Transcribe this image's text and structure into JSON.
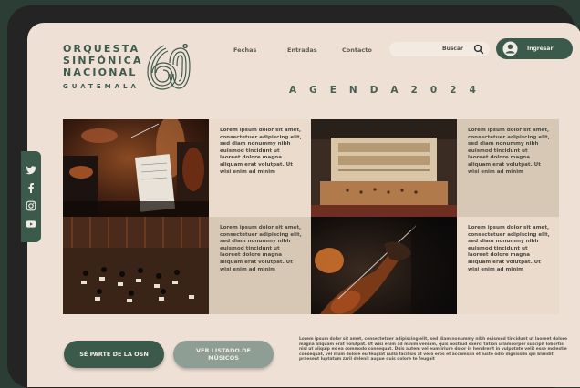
{
  "logo": {
    "line1": "ORQUESTA",
    "line2": "SINFÓNICA",
    "line3": "NACIONAL",
    "sub": "GUATEMALA",
    "degree": "o"
  },
  "nav": {
    "links": [
      "Fechas",
      "Entradas",
      "Contacto"
    ],
    "search_label": "Buscar",
    "login_label": "Ingresar"
  },
  "agenda_title": "AGENDA2024",
  "cards": [
    {
      "text": "Lorem ipsum dolor sit amet, consectetuer adipiscing elit, sed diam nonummy nibh euismod tincidunt ut laoreet dolore magna aliquam erat volutpat. Ut wisi enim ad minim"
    },
    {
      "text": "Lorem ipsum dolor sit amet, consectetuer adipiscing elit, sed diam nonummy nibh euismod tincidunt ut laoreet dolore magna aliquam erat volutpat. Ut wisi enim ad minim"
    },
    {
      "text": "Lorem ipsum dolor sit amet, consectetuer adipiscing elit, sed diam nonummy nibh euismod tincidunt ut laoreet dolore magna aliquam erat volutpat. Ut wisi enim ad minim"
    },
    {
      "text": "Lorem ipsum dolor sit amet, consectetuer adipiscing elit, sed diam nonummy nibh euismod tincidunt ut laoreet dolore magna aliquam erat volutpat. Ut wisi enim ad minim"
    }
  ],
  "social_icons": [
    "twitter-icon",
    "facebook-icon",
    "instagram-icon",
    "youtube-icon"
  ],
  "buttons": {
    "join": "SÉ PARTE DE LA OSN",
    "musicians": "VER LISTADO DE MÚSICOS"
  },
  "footer_text": "Lorem ipsum dolor sit amet, consectetuer adipiscing elit, sed diam nonummy nibh euismod tincidunt ut laoreet dolore magna aliquam erat volutpat. Ut wisi enim ad minim veniam, quis nostrud exerci tation ullamcorper suscipit lobortis nisl ut aliquip ex ea commodo consequat. Duis autem vel eum iriure dolor in hendrerit in vulputate velit esse molestie consequat, vel illum dolore eu feugiat nulla facilisis at vero eros et accumsan et iusto odio dignissim qui blandit praesent luptatum zzril delenit augue duis dolore te feugait",
  "colors": {
    "brand_green": "#3c5a4c",
    "background": "#eee0d4",
    "muted_green": "#8e9e94"
  }
}
